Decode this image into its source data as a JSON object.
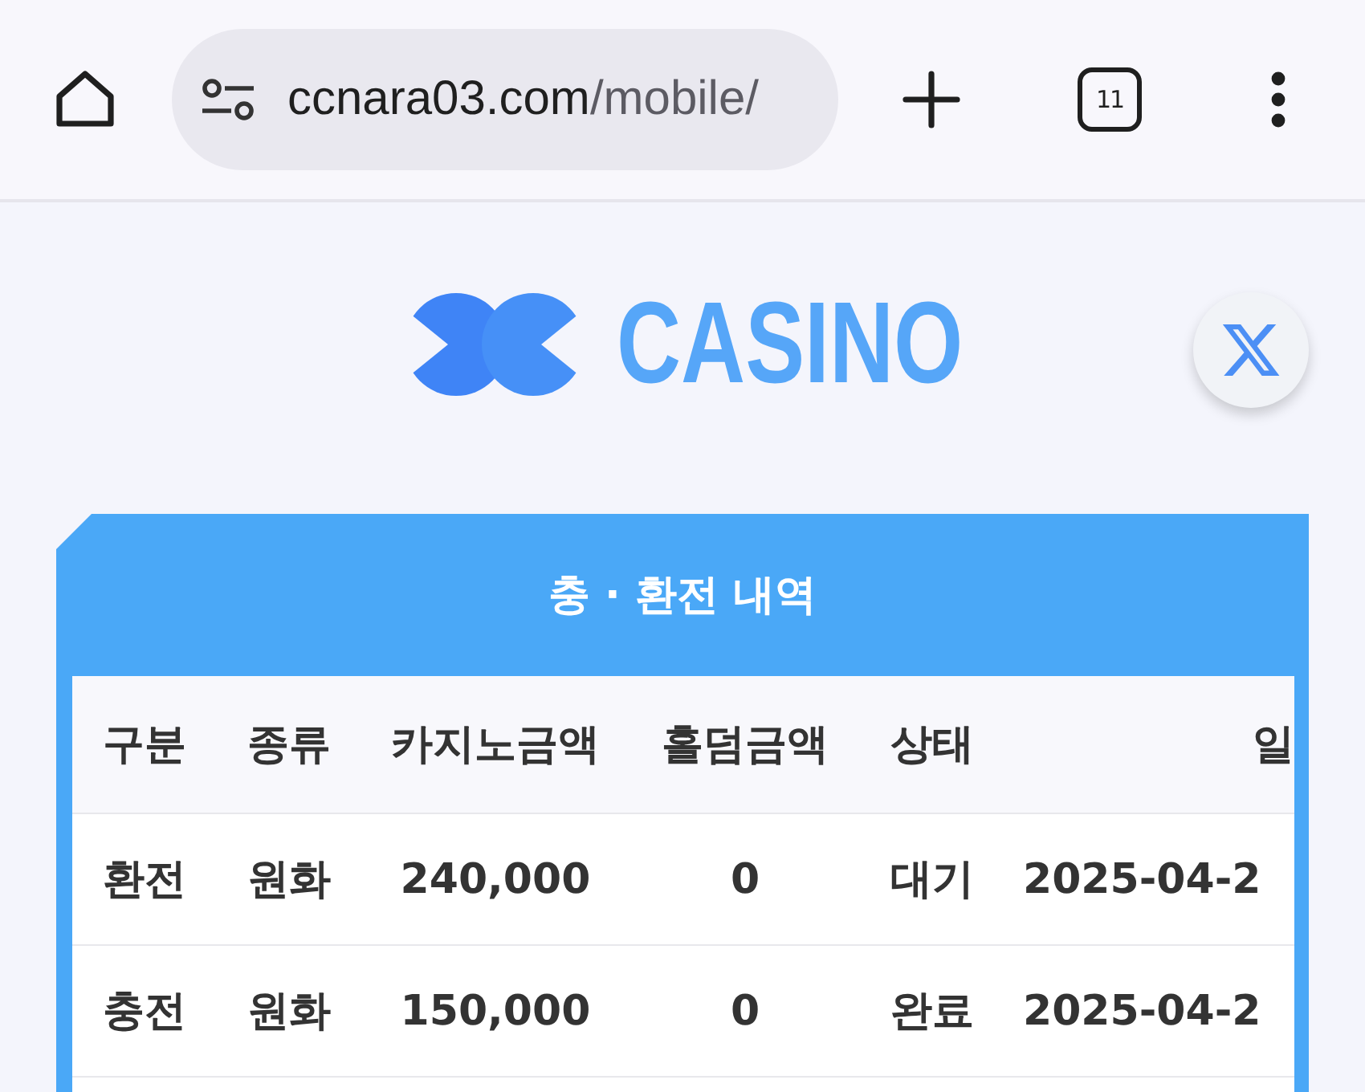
{
  "browser": {
    "url_host": "ccnara03.com",
    "url_path": "/mobile/",
    "tab_count": "11"
  },
  "header": {
    "logo_text": "CASINO"
  },
  "panel": {
    "title": "충 · 환전 내역",
    "table": {
      "columns": [
        "구분",
        "종류",
        "카지노금액",
        "홀덤금액",
        "상태",
        "일"
      ],
      "rows": [
        [
          "환전",
          "원화",
          "240,000",
          "0",
          "대기",
          "2025-04-2"
        ],
        [
          "충전",
          "원화",
          "150,000",
          "0",
          "완료",
          "2025-04-2"
        ]
      ]
    }
  }
}
